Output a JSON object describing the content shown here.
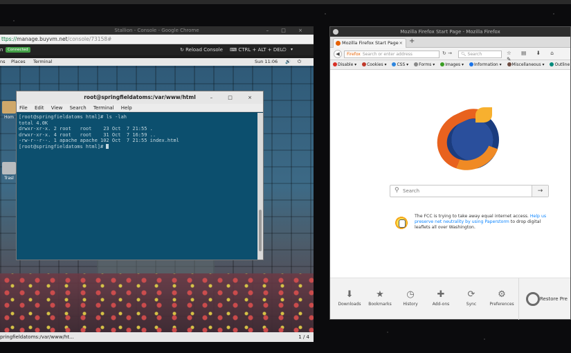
{
  "chrome": {
    "window_title": "Stallion - Console - Google Chrome",
    "window_controls": "– □ ×",
    "url_scheme": "ttps://",
    "url_host": "manage.buyvm.net",
    "url_path": "/console/73158#",
    "console_name": "n",
    "status_badge": "Connected",
    "reload_label": "Reload Console",
    "cad_label": "CTRL + ALT + DEL",
    "power_icon": "power-icon",
    "status_url": "pringfieldatoms:/var/www/ht...",
    "page_indicator": "1 / 4"
  },
  "gnome": {
    "menu_apps": "ns",
    "menu_places": "Places",
    "menu_terminal": "Terminal",
    "clock": "Sun 11:06",
    "desktop_home": "Hom",
    "desktop_trash": "Trasl"
  },
  "terminal": {
    "title": "root@springfieldatoms:/var/www/html",
    "controls": "– □ ×",
    "menu": [
      "File",
      "Edit",
      "View",
      "Search",
      "Terminal",
      "Help"
    ],
    "lines": [
      "[root@springfieldatoms html]# ls -lah",
      "total 4.0K",
      "drwxr-xr-x. 2 root   root    23 Oct  7 21:55 .",
      "drwxr-xr-x. 4 root   root    31 Oct  7 16:59 ..",
      "-rw-r--r--. 1 apache apache 102 Oct  7 21:55 index.html"
    ],
    "prompt": "[root@springfieldatoms html]# "
  },
  "firefox": {
    "window_title": "Mozilla Firefox Start Page - Mozilla Firefox",
    "tab_label": "Mozilla Firefox Start Page",
    "tab_close": "×",
    "new_tab": "+",
    "url_badge": "Firefox",
    "url_placeholder": "Search or enter address",
    "search_placeholder": "Search",
    "toolbar_icons": "☆ ▤ ⬇ ⌂ ✎",
    "dev_toolbar": [
      {
        "label": "Disable",
        "color": "#d93025"
      },
      {
        "label": "Cookies",
        "color": "#c0392b"
      },
      {
        "label": "CSS",
        "color": "#2e86de"
      },
      {
        "label": "Forms",
        "color": "#888888"
      },
      {
        "label": "Images",
        "color": "#3a9d23"
      },
      {
        "label": "Information",
        "color": "#1a73e8"
      },
      {
        "label": "Miscellaneous",
        "color": "#6d4c41"
      },
      {
        "label": "Outline",
        "color": "#00897b"
      }
    ],
    "page_search_placeholder": "Search",
    "snippet_text": "The FCC is trying to take away equal internet access. ",
    "snippet_link1": "Help us preserve net neutrality by using Paperstorm",
    "snippet_text2": " to drop digital leaflets all over Washington.",
    "footer": [
      {
        "label": "Downloads",
        "icon": "download-icon"
      },
      {
        "label": "Bookmarks",
        "icon": "star-icon"
      },
      {
        "label": "History",
        "icon": "clock-icon"
      },
      {
        "label": "Add-ons",
        "icon": "puzzle-icon"
      },
      {
        "label": "Sync",
        "icon": "sync-icon"
      },
      {
        "label": "Preferences",
        "icon": "gear-icon"
      }
    ],
    "restore_label": "Restore Pre"
  }
}
